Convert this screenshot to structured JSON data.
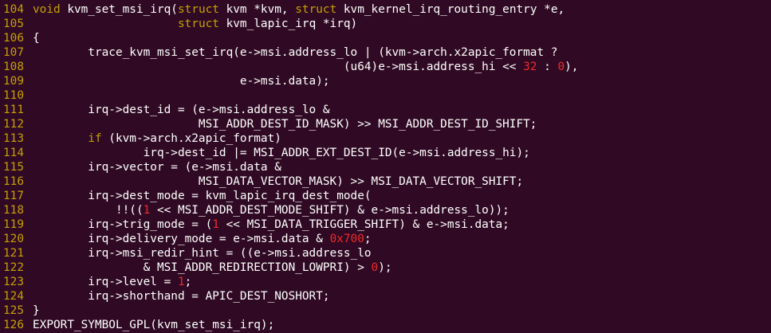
{
  "colors": {
    "background": "#300a24",
    "line_number": "#c4a000",
    "keyword": "#c4a000",
    "number": "#ef2929",
    "text": "#ffffff"
  },
  "lines": [
    {
      "num": "104",
      "segments": [
        {
          "t": "txt",
          "v": ""
        },
        {
          "t": "kw",
          "v": "void"
        },
        {
          "t": "txt",
          "v": " kvm_set_msi_irq("
        },
        {
          "t": "kw",
          "v": "struct"
        },
        {
          "t": "txt",
          "v": " kvm *kvm, "
        },
        {
          "t": "kw",
          "v": "struct"
        },
        {
          "t": "txt",
          "v": " kvm_kernel_irq_routing_entry *e,"
        }
      ]
    },
    {
      "num": "105",
      "segments": [
        {
          "t": "txt",
          "v": "                     "
        },
        {
          "t": "kw",
          "v": "struct"
        },
        {
          "t": "txt",
          "v": " kvm_lapic_irq *irq)"
        }
      ]
    },
    {
      "num": "106",
      "segments": [
        {
          "t": "txt",
          "v": "{"
        }
      ]
    },
    {
      "num": "107",
      "segments": [
        {
          "t": "txt",
          "v": "        trace_kvm_msi_set_irq(e->msi.address_lo | (kvm->arch.x2apic_format ?"
        }
      ]
    },
    {
      "num": "108",
      "segments": [
        {
          "t": "txt",
          "v": "                                             (u64)e->msi.address_hi << "
        },
        {
          "t": "num",
          "v": "32"
        },
        {
          "t": "txt",
          "v": " : "
        },
        {
          "t": "num",
          "v": "0"
        },
        {
          "t": "txt",
          "v": "),"
        }
      ]
    },
    {
      "num": "109",
      "segments": [
        {
          "t": "txt",
          "v": "                              e->msi.data);"
        }
      ]
    },
    {
      "num": "110",
      "segments": [
        {
          "t": "txt",
          "v": ""
        }
      ]
    },
    {
      "num": "111",
      "segments": [
        {
          "t": "txt",
          "v": "        irq->dest_id = (e->msi.address_lo &"
        }
      ]
    },
    {
      "num": "112",
      "segments": [
        {
          "t": "txt",
          "v": "                        MSI_ADDR_DEST_ID_MASK) >> MSI_ADDR_DEST_ID_SHIFT;"
        }
      ]
    },
    {
      "num": "113",
      "segments": [
        {
          "t": "txt",
          "v": "        "
        },
        {
          "t": "kw",
          "v": "if"
        },
        {
          "t": "txt",
          "v": " (kvm->arch.x2apic_format)"
        }
      ]
    },
    {
      "num": "114",
      "segments": [
        {
          "t": "txt",
          "v": "                irq->dest_id |= MSI_ADDR_EXT_DEST_ID(e->msi.address_hi);"
        }
      ]
    },
    {
      "num": "115",
      "segments": [
        {
          "t": "txt",
          "v": "        irq->vector = (e->msi.data &"
        }
      ]
    },
    {
      "num": "116",
      "segments": [
        {
          "t": "txt",
          "v": "                        MSI_DATA_VECTOR_MASK) >> MSI_DATA_VECTOR_SHIFT;"
        }
      ]
    },
    {
      "num": "117",
      "segments": [
        {
          "t": "txt",
          "v": "        irq->dest_mode = kvm_lapic_irq_dest_mode("
        }
      ]
    },
    {
      "num": "118",
      "segments": [
        {
          "t": "txt",
          "v": "            !!(("
        },
        {
          "t": "num",
          "v": "1"
        },
        {
          "t": "txt",
          "v": " << MSI_ADDR_DEST_MODE_SHIFT) & e->msi.address_lo));"
        }
      ]
    },
    {
      "num": "119",
      "segments": [
        {
          "t": "txt",
          "v": "        irq->trig_mode = ("
        },
        {
          "t": "num",
          "v": "1"
        },
        {
          "t": "txt",
          "v": " << MSI_DATA_TRIGGER_SHIFT) & e->msi.data;"
        }
      ]
    },
    {
      "num": "120",
      "segments": [
        {
          "t": "txt",
          "v": "        irq->delivery_mode = e->msi.data & "
        },
        {
          "t": "num",
          "v": "0x700"
        },
        {
          "t": "txt",
          "v": ";"
        }
      ]
    },
    {
      "num": "121",
      "segments": [
        {
          "t": "txt",
          "v": "        irq->msi_redir_hint = ((e->msi.address_lo"
        }
      ]
    },
    {
      "num": "122",
      "segments": [
        {
          "t": "txt",
          "v": "                & MSI_ADDR_REDIRECTION_LOWPRI) > "
        },
        {
          "t": "num",
          "v": "0"
        },
        {
          "t": "txt",
          "v": ");"
        }
      ]
    },
    {
      "num": "123",
      "segments": [
        {
          "t": "txt",
          "v": "        irq->level = "
        },
        {
          "t": "num",
          "v": "1"
        },
        {
          "t": "txt",
          "v": ";"
        }
      ]
    },
    {
      "num": "124",
      "segments": [
        {
          "t": "txt",
          "v": "        irq->shorthand = APIC_DEST_NOSHORT;"
        }
      ]
    },
    {
      "num": "125",
      "segments": [
        {
          "t": "txt",
          "v": "}"
        }
      ]
    },
    {
      "num": "126",
      "segments": [
        {
          "t": "txt",
          "v": "EXPORT_SYMBOL_GPL(kvm_set_msi_irq);"
        }
      ]
    }
  ]
}
